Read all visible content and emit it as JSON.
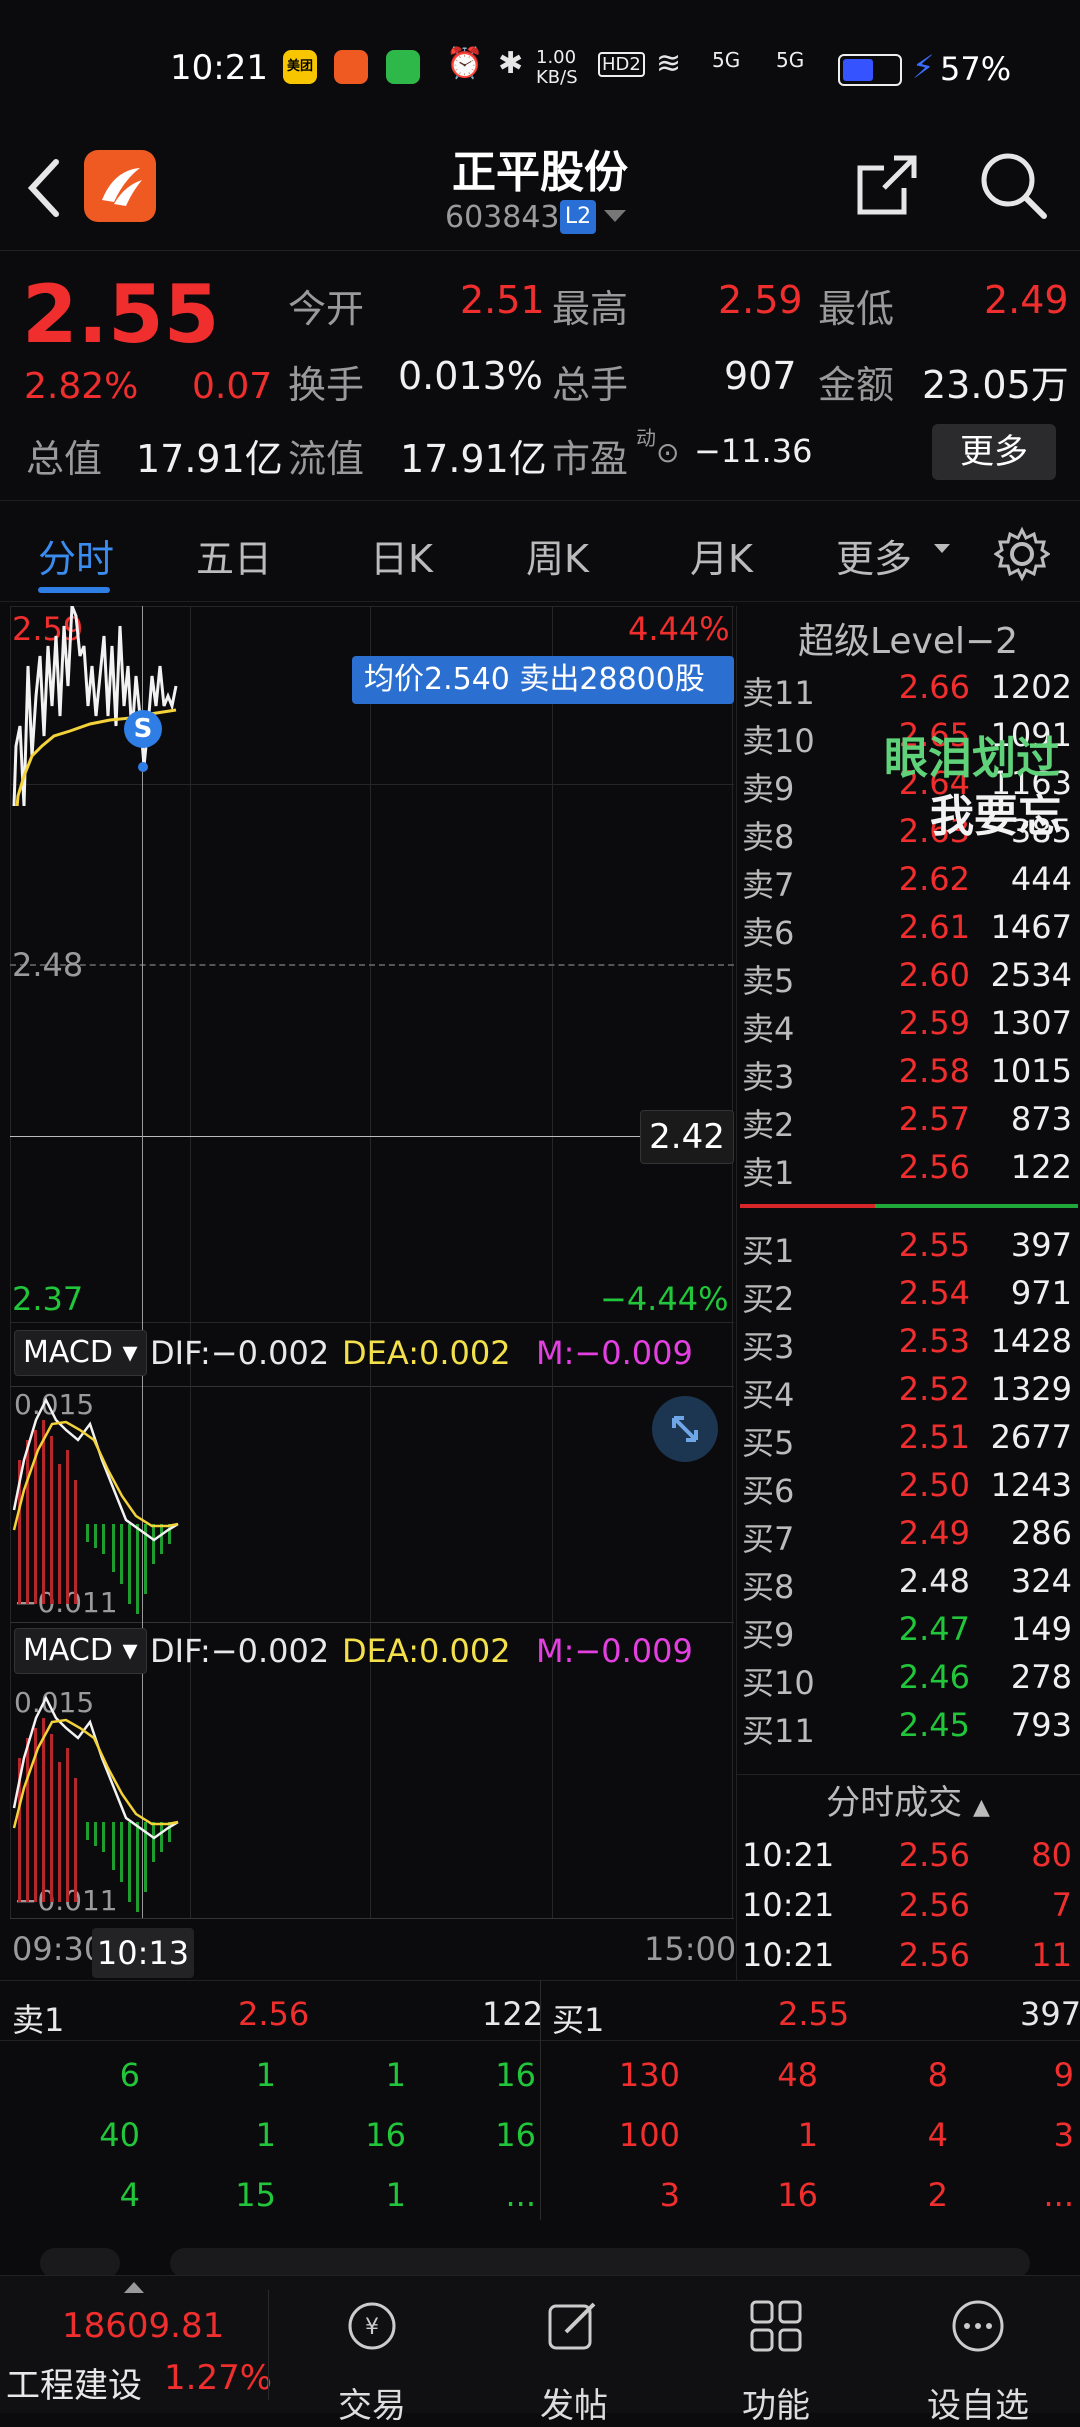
{
  "status_bar": {
    "time": "10:21",
    "app_icons": [
      "美团",
      "",
      ""
    ],
    "speed": "1.00 KB/S",
    "hd": "HD2",
    "signal1": "5G",
    "signal2": "5G",
    "battery": "57%"
  },
  "header": {
    "title": "正平股份",
    "code": "603843",
    "badge": "L2"
  },
  "quote": {
    "price": "2.55",
    "change_pct": "2.82%",
    "change": "0.07",
    "open_label": "今开",
    "open": "2.51",
    "high_label": "最高",
    "high": "2.59",
    "low_label": "最低",
    "low": "2.49",
    "turnover_label": "换手",
    "turnover": "0.013%",
    "volume_label": "总手",
    "volume": "907",
    "amount_label": "金额",
    "amount": "23.05万",
    "mktcap_label": "总值",
    "mktcap": "17.91亿",
    "float_label": "流值",
    "float": "17.91亿",
    "pe_label": "市盈",
    "pe_sup": "动",
    "pe": "−11.36",
    "more": "更多"
  },
  "tabs": [
    "分时",
    "五日",
    "日K",
    "周K",
    "月K",
    "更多"
  ],
  "chart": {
    "top_left": "2.59",
    "top_right": "4.44%",
    "mid_left": "2.48",
    "bottom_left": "2.37",
    "bottom_right": "−4.44%",
    "price_tag": "2.42",
    "tooltip": "均价2.540    卖出28800股",
    "marker": "S",
    "macd1": {
      "label": "MACD",
      "dif": "DIF:−0.002",
      "dea": "DEA:0.002",
      "m": "M:−0.009",
      "top": "0.015",
      "bottom": "−0.011"
    },
    "macd2": {
      "label": "MACD",
      "dif": "DIF:−0.002",
      "dea": "DEA:0.002",
      "m": "M:−0.009",
      "top": "0.015",
      "bottom": "−0.011"
    },
    "time_start": "09:30",
    "time_cursor": "10:13",
    "time_end": "15:00"
  },
  "order_book": {
    "title": "超级Level−2",
    "overlay1": "眼泪划过",
    "overlay2": "我要忘",
    "asks": [
      {
        "n": "卖11",
        "p": "2.66",
        "v": "1202"
      },
      {
        "n": "卖10",
        "p": "2.65",
        "v": "1091"
      },
      {
        "n": "卖9",
        "p": "2.64",
        "v": "1163"
      },
      {
        "n": "卖8",
        "p": "2.63",
        "v": "385"
      },
      {
        "n": "卖7",
        "p": "2.62",
        "v": "444"
      },
      {
        "n": "卖6",
        "p": "2.61",
        "v": "1467"
      },
      {
        "n": "卖5",
        "p": "2.60",
        "v": "2534"
      },
      {
        "n": "卖4",
        "p": "2.59",
        "v": "1307"
      },
      {
        "n": "卖3",
        "p": "2.58",
        "v": "1015"
      },
      {
        "n": "卖2",
        "p": "2.57",
        "v": "873"
      },
      {
        "n": "卖1",
        "p": "2.56",
        "v": "122"
      }
    ],
    "bids": [
      {
        "n": "买1",
        "p": "2.55",
        "v": "397",
        "c": "red"
      },
      {
        "n": "买2",
        "p": "2.54",
        "v": "971",
        "c": "red"
      },
      {
        "n": "买3",
        "p": "2.53",
        "v": "1428",
        "c": "red"
      },
      {
        "n": "买4",
        "p": "2.52",
        "v": "1329",
        "c": "red"
      },
      {
        "n": "买5",
        "p": "2.51",
        "v": "2677",
        "c": "red"
      },
      {
        "n": "买6",
        "p": "2.50",
        "v": "1243",
        "c": "red"
      },
      {
        "n": "买7",
        "p": "2.49",
        "v": "286",
        "c": "red"
      },
      {
        "n": "买8",
        "p": "2.48",
        "v": "324",
        "c": "white"
      },
      {
        "n": "买9",
        "p": "2.47",
        "v": "149",
        "c": "green"
      },
      {
        "n": "买10",
        "p": "2.46",
        "v": "278",
        "c": "green"
      },
      {
        "n": "买11",
        "p": "2.45",
        "v": "793",
        "c": "green"
      }
    ],
    "fenshi_title": "分时成交",
    "trades": [
      {
        "t": "10:21",
        "p": "2.56",
        "v": "80"
      },
      {
        "t": "10:21",
        "p": "2.56",
        "v": "7"
      },
      {
        "t": "10:21",
        "p": "2.56",
        "v": "11"
      }
    ]
  },
  "queue": {
    "sell_label": "卖1",
    "sell_price": "2.56",
    "sell_vol": "122",
    "buy_label": "买1",
    "buy_price": "2.55",
    "buy_vol": "397",
    "sell_rows": [
      [
        "6",
        "1",
        "1",
        "16"
      ],
      [
        "40",
        "1",
        "16",
        "16"
      ],
      [
        "4",
        "15",
        "1",
        "..."
      ]
    ],
    "buy_rows": [
      [
        "130",
        "48",
        "8",
        "9"
      ],
      [
        "100",
        "1",
        "4",
        "3"
      ],
      [
        "3",
        "16",
        "2",
        "..."
      ]
    ]
  },
  "bottom_bar": {
    "index_value": "18609.81",
    "index_name": "工程建设",
    "index_change": "1.27%",
    "items": [
      "交易",
      "发帖",
      "功能",
      "设自选"
    ]
  },
  "colors": {
    "up": "#f02e2e",
    "down": "#21c63a",
    "accent": "#2f7ee6",
    "bg": "#0b0b0d"
  }
}
